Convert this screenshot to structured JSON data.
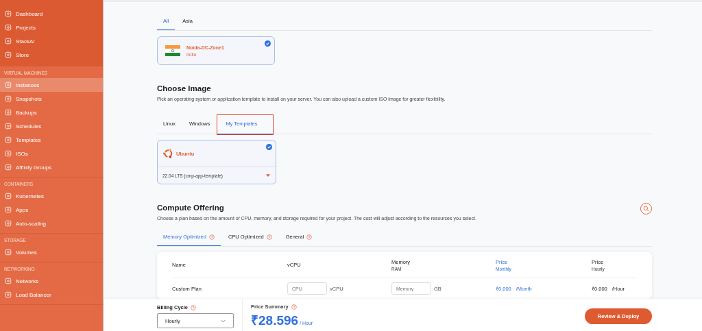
{
  "sidebar": {
    "groups": [
      {
        "items": [
          {
            "label": "Dashboard",
            "selected": false
          },
          {
            "label": "Projects",
            "selected": false
          },
          {
            "label": "StackAI",
            "selected": false
          },
          {
            "label": "Store",
            "selected": false
          }
        ]
      },
      {
        "heading": "VIRTUAL MACHINES",
        "items": [
          {
            "label": "Instances",
            "selected": true
          },
          {
            "label": "Snapshots",
            "selected": false
          },
          {
            "label": "Backups",
            "selected": false
          },
          {
            "label": "Schedules",
            "selected": false
          },
          {
            "label": "Templates",
            "selected": false
          },
          {
            "label": "ISOs",
            "selected": false
          },
          {
            "label": "Affinity Groups",
            "selected": false
          }
        ]
      },
      {
        "heading": "CONTAINERS",
        "items": [
          {
            "label": "Kubernetes",
            "selected": false
          },
          {
            "label": "Apps",
            "selected": false
          },
          {
            "label": "Auto-scaling",
            "selected": false
          }
        ]
      },
      {
        "heading": "STORAGE",
        "items": [
          {
            "label": "Volumes",
            "selected": false
          }
        ]
      },
      {
        "heading": "NETWORKING",
        "items": [
          {
            "label": "Networks",
            "selected": false
          },
          {
            "label": "Load Balancer",
            "selected": false
          }
        ]
      }
    ]
  },
  "region": {
    "tabs": [
      {
        "label": "All",
        "selected": true
      },
      {
        "label": "Asia",
        "selected": false
      }
    ],
    "zones": [
      {
        "name": "Noida-DC-Zone1",
        "country": "India",
        "selected": true
      }
    ]
  },
  "image": {
    "title": "Choose Image",
    "description": "Pick an operating system or application template to install on your server. You can also upload a custom ISO image for greater flexibility.",
    "tabs": [
      {
        "label": "Linux",
        "selected": false,
        "highlighted": false
      },
      {
        "label": "Windows",
        "selected": false,
        "highlighted": false
      },
      {
        "label": "My Templates",
        "selected": true,
        "highlighted": true
      }
    ],
    "templates": [
      {
        "name": "Ubuntu",
        "version": "22.04 LTS (cmp-app-template)",
        "selected": true
      }
    ]
  },
  "compute": {
    "title": "Compute Offering",
    "description": "Choose a plan based on the amount of CPU, memory, and storage required for your project. The cost will adjust according to the resources you select.",
    "tabs": [
      {
        "label": "Memory Optimized",
        "selected": true
      },
      {
        "label": "CPU Optimized",
        "selected": false
      },
      {
        "label": "General",
        "selected": false
      }
    ],
    "table": {
      "columns": [
        {
          "title": "Name",
          "highlighted": false
        },
        {
          "title": "vCPU",
          "highlighted": false
        },
        {
          "title": "Memory",
          "subtitle": "RAM",
          "highlighted": false
        },
        {
          "title": "Price",
          "subtitle": "Monthly",
          "highlighted": true
        },
        {
          "title": "Price",
          "subtitle": "Hourly",
          "highlighted": false
        }
      ],
      "rows": [
        {
          "name": "Custom Plan",
          "cpu_placeholder": "CPU",
          "cpu_unit": "vCPU",
          "memory_placeholder": "Memory",
          "memory_unit": "GB",
          "monthly_price": "₹0.000",
          "monthly_unit": "/Month",
          "hourly_price": "₹0.000",
          "hourly_unit": "/Hour"
        }
      ]
    }
  },
  "footer": {
    "billing_label": "Billing Cycle",
    "billing_value": "Hourly",
    "price_label": "Price Summary",
    "price": "₹28.596",
    "price_unit": "/ Hour",
    "button": "Review & Deploy"
  }
}
